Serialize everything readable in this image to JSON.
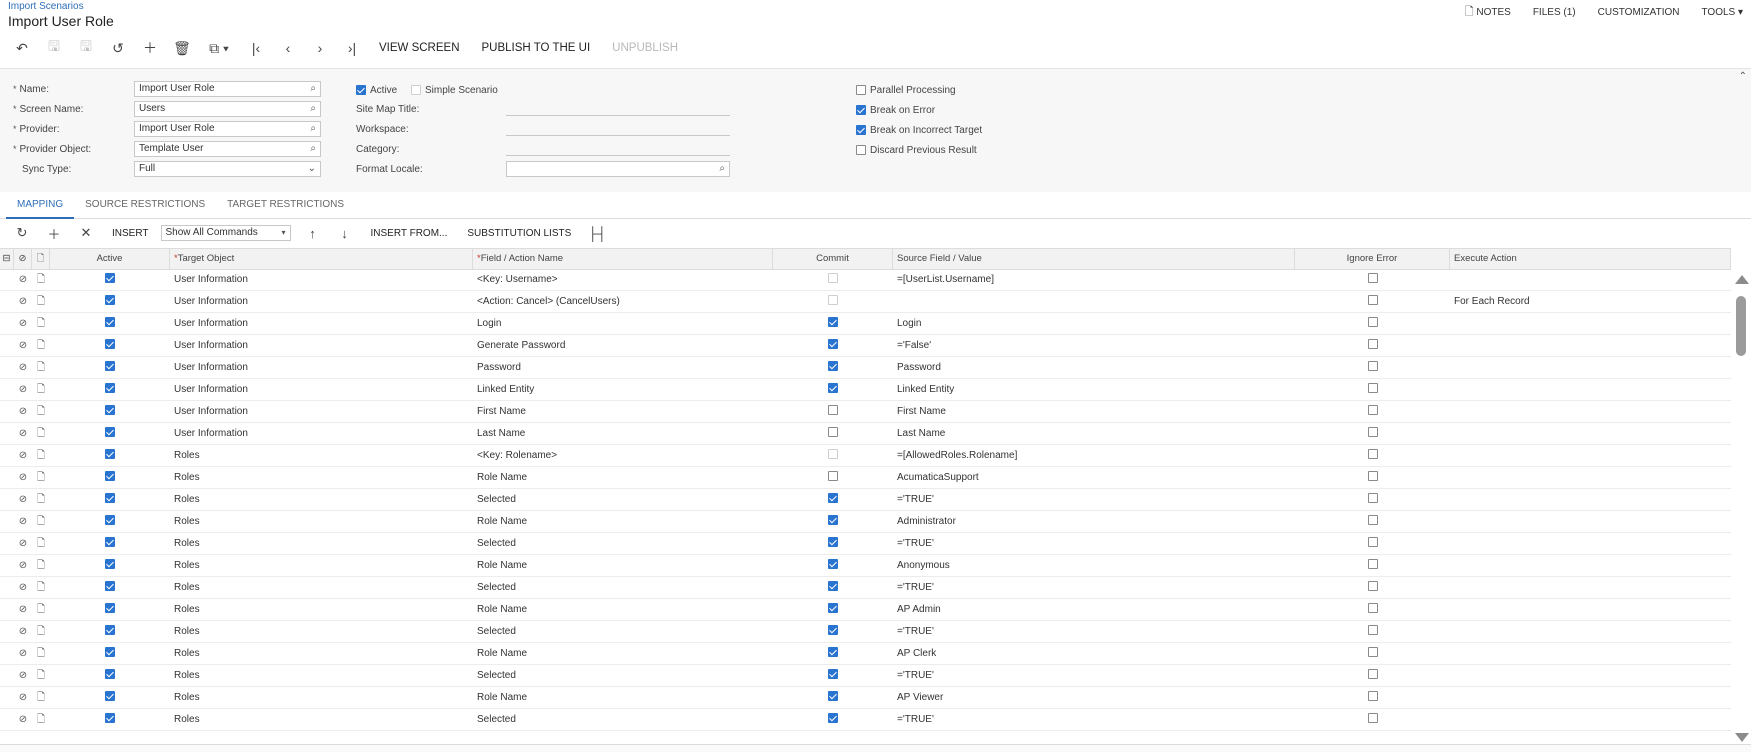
{
  "breadcrumb": "Import Scenarios",
  "title": "Import User Role",
  "topnav": [
    {
      "label": "NOTES",
      "icon": "document-icon"
    },
    {
      "label": "FILES (1)"
    },
    {
      "label": "CUSTOMIZATION"
    },
    {
      "label": "TOOLS ▾"
    }
  ],
  "toolbar": {
    "icons": [
      "undo-icon",
      "save-icon",
      "save-close-icon",
      "cancel-icon",
      "add-icon",
      "delete-icon",
      "copy-paste-icon",
      "first-record-icon",
      "previous-record-icon",
      "next-record-icon",
      "last-record-icon"
    ],
    "view_screen": "VIEW SCREEN",
    "publish": "PUBLISH TO THE UI",
    "unpublish": "UNPUBLISH"
  },
  "form": {
    "name_label": "Name:",
    "name_value": "Import User Role",
    "screen_label": "Screen Name:",
    "screen_value": "Users",
    "provider_label": "Provider:",
    "provider_value": "Import User Role",
    "provider_object_label": "Provider Object:",
    "provider_object_value": "Template User",
    "sync_type_label": "Sync Type:",
    "sync_type_value": "Full",
    "active_label": "Active",
    "active_checked": true,
    "simple_label": "Simple Scenario",
    "simple_checked": false,
    "site_map_label": "Site Map Title:",
    "site_map_value": "",
    "workspace_label": "Workspace:",
    "workspace_value": "",
    "category_label": "Category:",
    "category_value": "",
    "format_locale_label": "Format Locale:",
    "format_locale_value": "",
    "parallel_label": "Parallel Processing",
    "parallel_checked": false,
    "break_error_label": "Break on Error",
    "break_error_checked": true,
    "break_target_label": "Break on Incorrect Target",
    "break_target_checked": true,
    "discard_label": "Discard Previous Result",
    "discard_checked": false
  },
  "tabs": [
    {
      "label": "MAPPING",
      "active": true
    },
    {
      "label": "SOURCE RESTRICTIONS",
      "active": false
    },
    {
      "label": "TARGET RESTRICTIONS",
      "active": false
    }
  ],
  "gridbar": {
    "insert": "INSERT",
    "filter": "Show All Commands",
    "insert_from": "INSERT FROM...",
    "substitution": "SUBSTITUTION LISTS"
  },
  "columns": {
    "active": "Active",
    "target": "Target Object",
    "field": "Field / Action Name",
    "commit": "Commit",
    "source": "Source Field / Value",
    "ignore": "Ignore Error",
    "execute": "Execute Action"
  },
  "rows": [
    {
      "active": true,
      "target": "User Information",
      "field": "<Key: Username>",
      "commit": false,
      "commit_disabled": true,
      "source": "=[UserList.Username]",
      "ignore": false,
      "execute": ""
    },
    {
      "active": true,
      "target": "User Information",
      "field": "<Action: Cancel> (CancelUsers)",
      "commit": false,
      "commit_disabled": true,
      "source": "",
      "ignore": false,
      "execute": "For Each Record"
    },
    {
      "active": true,
      "target": "User Information",
      "field": "Login",
      "commit": true,
      "source": "Login",
      "ignore": false,
      "execute": ""
    },
    {
      "active": true,
      "target": "User Information",
      "field": "Generate Password",
      "commit": true,
      "source": "='False'",
      "ignore": false,
      "execute": ""
    },
    {
      "active": true,
      "target": "User Information",
      "field": "Password",
      "commit": true,
      "source": "Password",
      "ignore": false,
      "execute": ""
    },
    {
      "active": true,
      "target": "User Information",
      "field": "Linked Entity",
      "commit": true,
      "source": "Linked Entity",
      "ignore": false,
      "execute": ""
    },
    {
      "active": true,
      "target": "User Information",
      "field": "First Name",
      "commit": false,
      "source": "First Name",
      "ignore": false,
      "execute": ""
    },
    {
      "active": true,
      "target": "User Information",
      "field": "Last Name",
      "commit": false,
      "source": "Last Name",
      "ignore": false,
      "execute": ""
    },
    {
      "active": true,
      "target": "Roles",
      "field": "<Key: Rolename>",
      "commit": false,
      "commit_disabled": true,
      "source": "=[AllowedRoles.Rolename]",
      "ignore": false,
      "execute": ""
    },
    {
      "active": true,
      "target": "Roles",
      "field": "Role Name",
      "commit": false,
      "source": "AcumaticaSupport",
      "ignore": false,
      "execute": ""
    },
    {
      "active": true,
      "target": "Roles",
      "field": "Selected",
      "commit": true,
      "source": "='TRUE'",
      "ignore": false,
      "execute": ""
    },
    {
      "active": true,
      "target": "Roles",
      "field": "Role Name",
      "commit": true,
      "source": "Administrator",
      "ignore": false,
      "execute": ""
    },
    {
      "active": true,
      "target": "Roles",
      "field": "Selected",
      "commit": true,
      "source": "='TRUE'",
      "ignore": false,
      "execute": ""
    },
    {
      "active": true,
      "target": "Roles",
      "field": "Role Name",
      "commit": true,
      "source": "Anonymous",
      "ignore": false,
      "execute": ""
    },
    {
      "active": true,
      "target": "Roles",
      "field": "Selected",
      "commit": true,
      "source": "='TRUE'",
      "ignore": false,
      "execute": ""
    },
    {
      "active": true,
      "target": "Roles",
      "field": "Role Name",
      "commit": true,
      "source": "AP Admin",
      "ignore": false,
      "execute": ""
    },
    {
      "active": true,
      "target": "Roles",
      "field": "Selected",
      "commit": true,
      "source": "='TRUE'",
      "ignore": false,
      "execute": ""
    },
    {
      "active": true,
      "target": "Roles",
      "field": "Role Name",
      "commit": true,
      "source": "AP Clerk",
      "ignore": false,
      "execute": ""
    },
    {
      "active": true,
      "target": "Roles",
      "field": "Selected",
      "commit": true,
      "source": "='TRUE'",
      "ignore": false,
      "execute": ""
    },
    {
      "active": true,
      "target": "Roles",
      "field": "Role Name",
      "commit": true,
      "source": "AP Viewer",
      "ignore": false,
      "execute": ""
    },
    {
      "active": true,
      "target": "Roles",
      "field": "Selected",
      "commit": true,
      "source": "='TRUE'",
      "ignore": false,
      "execute": ""
    }
  ]
}
